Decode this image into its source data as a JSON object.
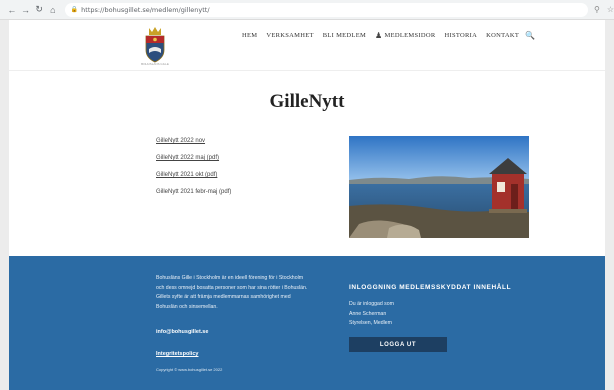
{
  "browser": {
    "url": "https://bohusgillet.se/medlem/gillenytt/",
    "icons": [
      "back-arrow-icon",
      "forward-arrow-icon",
      "reload-icon",
      "home-icon",
      "lock-icon",
      "zoom-icon",
      "star-icon",
      "extension-icon"
    ]
  },
  "site": {
    "logo_caption": "BOHUSLÄNS GILLE",
    "menu": [
      {
        "label": "HEM"
      },
      {
        "label": "VERKSAMHET"
      },
      {
        "label": "BLI MEDLEM"
      },
      {
        "label": "MEDLEMSIDOR"
      },
      {
        "label": "HISTORIA"
      },
      {
        "label": "KONTAKT"
      }
    ]
  },
  "page": {
    "title": "GilleNytt",
    "links": [
      {
        "label": "GilleNytt 2022 nov"
      },
      {
        "label": "GilleNytt 2022 maj (pdf)"
      },
      {
        "label": "GilleNytt 2021 okt (pdf)"
      },
      {
        "label": "GilleNytt 2021 febr-maj (pdf)"
      }
    ]
  },
  "footer": {
    "about_lines": [
      "Bohusläns Gille i Stockholm är en ideell förening för i Stockholm",
      "och dess omnejd bosatta personer som har sina rötter i Bohuslän.",
      "Gillets syfte är att främja medlemmarnas samhörighet med",
      "Bohuslän och sinsemellan."
    ],
    "email": "info@bohusgillet.se",
    "policy": "Integritetspolicy",
    "copyright": "Copyright © www.bohusgillet.se 2022",
    "login_heading": "INLOGGNING MEDLEMSSKYDDAT INNEHÅLL",
    "login_lines": [
      "Du är inloggad som",
      "Anne Scherman",
      "Styrelsen, Medlem"
    ],
    "logout_label": "LOGGA UT"
  },
  "colors": {
    "footer_bg": "#2b6ba4",
    "logout_bg": "#1d3f62",
    "page_bg": "#ffffff",
    "chrome_bg": "#f1f3f4"
  }
}
